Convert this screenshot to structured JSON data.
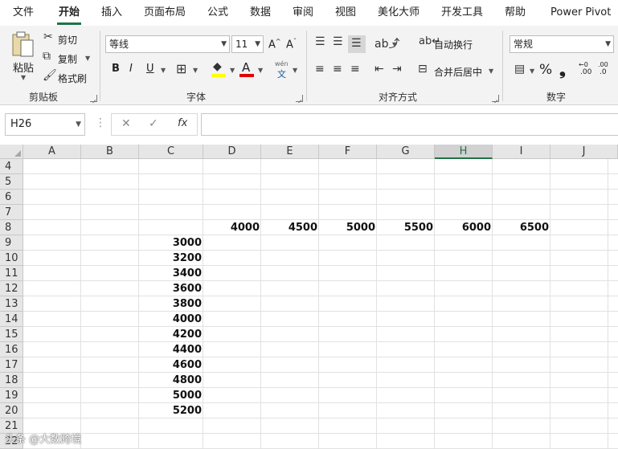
{
  "ribbon_tabs": [
    "文件",
    "开始",
    "插入",
    "页面布局",
    "公式",
    "数据",
    "审阅",
    "视图",
    "美化大师",
    "开发工具",
    "帮助",
    "Power Pivot"
  ],
  "active_tab": "开始",
  "clipboard": {
    "paste": "粘贴",
    "cut": "剪切",
    "copy": "复制",
    "format_painter": "格式刷",
    "group": "剪贴板"
  },
  "font": {
    "name": "等线",
    "size": "11",
    "bold": "B",
    "italic": "I",
    "underline": "U",
    "group": "字体",
    "phonetic_top": "wén",
    "phonetic_bottom": "文"
  },
  "alignment": {
    "wrap": "自动换行",
    "merge": "合并后居中",
    "group": "对齐方式"
  },
  "number": {
    "format": "常规",
    "group": "数字",
    "percent": "%",
    "comma": "❟",
    "inc": ".00",
    "dec": ".0"
  },
  "formula_bar": {
    "name_box": "H26",
    "fx": "fx",
    "value": ""
  },
  "grid": {
    "columns": [
      "A",
      "B",
      "C",
      "D",
      "E",
      "F",
      "G",
      "H",
      "I",
      "J"
    ],
    "selected_column": "H",
    "rows": [
      "4",
      "5",
      "6",
      "7",
      "8",
      "9",
      "10",
      "11",
      "12",
      "13",
      "14",
      "15",
      "16",
      "17",
      "18",
      "19",
      "20",
      "21",
      "22"
    ],
    "row8_values": [
      "4000",
      "4500",
      "5000",
      "5500",
      "6000",
      "6500"
    ],
    "colC_values": [
      "3000",
      "3200",
      "3400",
      "3600",
      "3800",
      "4000",
      "4200",
      "4400",
      "4600",
      "4800",
      "5000",
      "5200"
    ]
  },
  "watermark": "头条 @大数跨境"
}
